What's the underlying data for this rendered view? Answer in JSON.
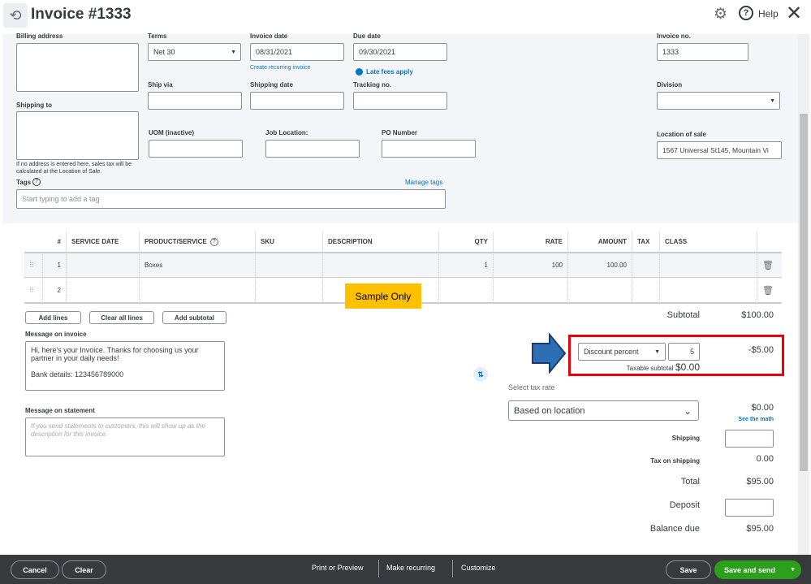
{
  "header": {
    "title": "Invoice #1333",
    "help": "Help"
  },
  "form": {
    "billing_address_label": "Billing address",
    "terms_label": "Terms",
    "terms_value": "Net 30",
    "invoice_date_label": "Invoice date",
    "invoice_date": "08/31/2021",
    "due_date_label": "Due date",
    "due_date": "09/30/2021",
    "create_recurring": "Create recurring invoice",
    "late_fees": "Late fees apply",
    "invoice_no_label": "Invoice no.",
    "invoice_no": "1333",
    "ship_via_label": "Ship via",
    "shipping_date_label": "Shipping date",
    "tracking_label": "Tracking no.",
    "division_label": "Division",
    "shipping_to_label": "Shipping to",
    "uom_label": "UOM (inactive)",
    "job_location_label": "Job Location:",
    "po_label": "PO Number",
    "location_of_sale_label": "Location of sale",
    "location_of_sale": "1567 Universal St145, Mountain Vi",
    "address_note": "If no address is entered here, sales tax will be calculated at the Location of Sale.",
    "tags_label": "Tags",
    "manage_tags": "Manage tags",
    "tags_placeholder": "Start typing to add a tag"
  },
  "table": {
    "headers": [
      "#",
      "SERVICE DATE",
      "PRODUCT/SERVICE",
      "SKU",
      "DESCRIPTION",
      "QTY",
      "RATE",
      "AMOUNT",
      "TAX",
      "CLASS"
    ],
    "rows": [
      {
        "num": "1",
        "product": "Boxes",
        "qty": "1",
        "rate": "100",
        "amount": "100.00"
      },
      {
        "num": "2",
        "product": "",
        "qty": "",
        "rate": "",
        "amount": ""
      }
    ]
  },
  "sample_label": "Sample Only",
  "buttons": {
    "add_lines": "Add lines",
    "clear_all": "Clear all lines",
    "add_subtotal": "Add subtotal"
  },
  "message_invoice_label": "Message on invoice",
  "message_invoice": "Hi, here's your Invoice. Thanks for choosing us your partner in your daily needs!\n\nBank details: 123456789000",
  "message_statement_label": "Message on statement",
  "message_statement_placeholder": "If you send statements to customers, this will show up as the description for this invoice.",
  "totals": {
    "subtotal_label": "Subtotal",
    "subtotal": "$100.00",
    "discount_type": "Discount percent",
    "discount_value": "5",
    "discount_amount": "-$5.00",
    "taxable_label": "Taxable subtotal",
    "taxable": "$0.00",
    "tax_rate_label": "Select tax rate",
    "tax_rate": "Based on location",
    "tax": "$0.00",
    "see_math": "See the math",
    "shipping_label": "Shipping",
    "tax_shipping_label": "Tax on shipping",
    "tax_shipping": "0.00",
    "total_label": "Total",
    "total": "$95.00",
    "deposit_label": "Deposit",
    "balance_label": "Balance due",
    "balance": "$95.00"
  },
  "footer": {
    "cancel": "Cancel",
    "clear": "Clear",
    "print": "Print or Preview",
    "recurring": "Make recurring",
    "customize": "Customize",
    "save": "Save",
    "save_send": "Save and send"
  },
  "colors": {
    "accent": "#2ca01c",
    "highlight": "#e8000b",
    "arrow": "#2e6eb5",
    "sample": "#ffc000",
    "link": "#0077c5"
  }
}
